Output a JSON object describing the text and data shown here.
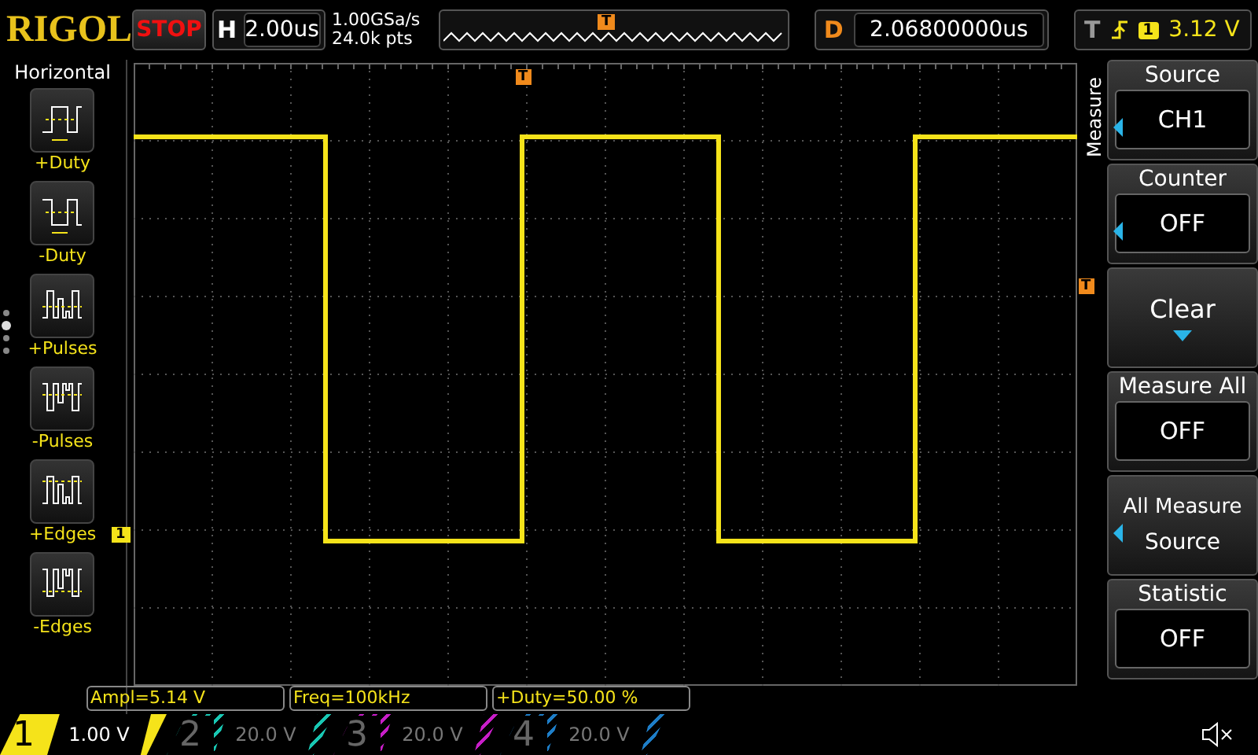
{
  "logo": "RIGOL",
  "run_state": "STOP",
  "horizontal": {
    "label": "H",
    "value": "2.00us"
  },
  "acquisition": {
    "sample_rate": "1.00GSa/s",
    "points": "24.0k pts"
  },
  "memory_marker": "T",
  "delay": {
    "label": "D",
    "value": "2.06800000us"
  },
  "trigger": {
    "label": "T",
    "channel": "1",
    "level": "3.12 V"
  },
  "left_menu": {
    "title": "Horizontal",
    "items": [
      {
        "kind": "plus_duty",
        "label": "+Duty"
      },
      {
        "kind": "minus_duty",
        "label": "-Duty"
      },
      {
        "kind": "plus_pulses",
        "label": "+Pulses"
      },
      {
        "kind": "minus_pulses",
        "label": "-Pulses"
      },
      {
        "kind": "plus_edges",
        "label": "+Edges"
      },
      {
        "kind": "minus_edges",
        "label": "-Edges"
      }
    ]
  },
  "markers": {
    "trigger_position": "T",
    "trigger_level": "T",
    "channel": "1"
  },
  "right_menu": {
    "title": "Measure",
    "items": [
      {
        "kind": "value",
        "label": "Source",
        "value": "CH1",
        "arrow": true
      },
      {
        "kind": "value",
        "label": "Counter",
        "value": "OFF",
        "arrow": true
      },
      {
        "kind": "action",
        "label": "Clear",
        "arrow": false
      },
      {
        "kind": "value",
        "label": "Measure All",
        "value": "OFF",
        "arrow": false
      },
      {
        "kind": "multiline",
        "label": "All Measure",
        "value": "Source",
        "arrow": true
      },
      {
        "kind": "value",
        "label": "Statistic",
        "value": "OFF",
        "arrow": false
      }
    ]
  },
  "measurements": [
    "Ampl=5.14 V",
    "Freq=100kHz",
    "+Duty=50.00 %"
  ],
  "channels": [
    {
      "number": "1",
      "scale": "1.00 V",
      "selected": true,
      "color": "#f5e31a"
    },
    {
      "number": "2",
      "scale": "20.0 V",
      "selected": false,
      "color": "#19c8b4"
    },
    {
      "number": "3",
      "scale": "20.0 V",
      "selected": false,
      "color": "#c81ec8"
    },
    {
      "number": "4",
      "scale": "20.0 V",
      "selected": false,
      "color": "#1e7ec8"
    }
  ]
}
